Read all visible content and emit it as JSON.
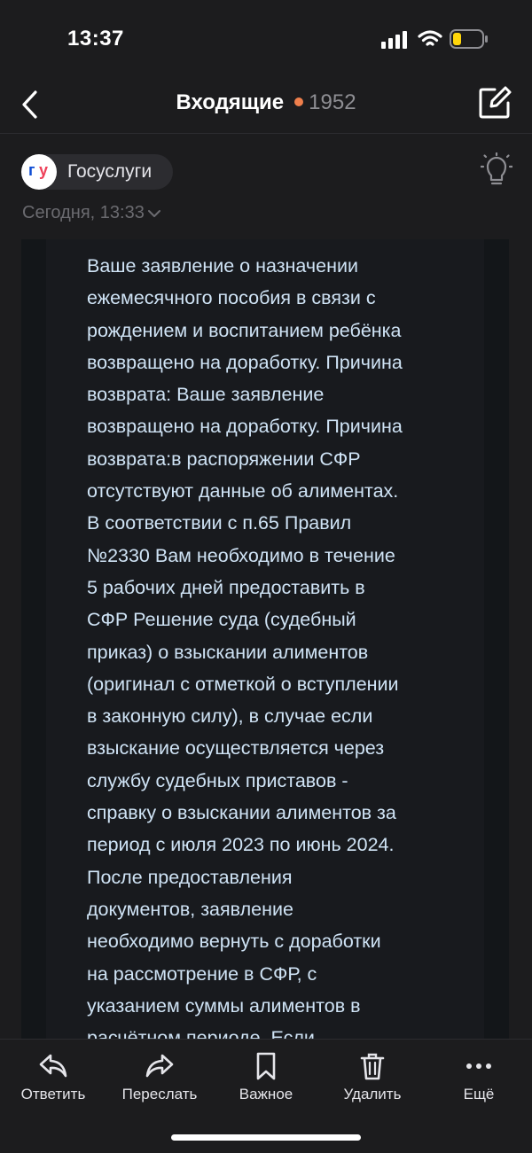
{
  "status_bar": {
    "time": "13:37",
    "battery_color": "#ffd60a"
  },
  "nav": {
    "title": "Входящие",
    "unread_count": "1952",
    "dot_color": "#ef7f4c"
  },
  "sender": {
    "name": "Госуслуги",
    "logo_text_g": "г",
    "logo_text_u": "у",
    "logo_colors": [
      "#0d4cd3",
      "#ee3f58"
    ]
  },
  "date": {
    "label": "Сегодня, 13:33"
  },
  "message": {
    "lines": [
      "Ваше заявление о назначении",
      "ежемесячного пособия в связи с",
      "рождением и воспитанием ребёнка",
      "возвращено на доработку. Причина",
      "возврата: Ваше заявление",
      "возвращено на доработку. Причина",
      "возврата:в распоряжении СФР",
      "отсутствуют данные об алиментах.",
      "В соответствии с п.65 Правил",
      "№2330 Вам необходимо в течение",
      "5 рабочих дней предоставить в",
      "СФР Решение суда (судебный",
      "приказ) о взыскании алиментов",
      "(оригинал с отметкой о вступлении",
      "в законную силу), в случае если",
      "взыскание осуществляется через",
      "службу судебных приставов -",
      "справку о взыскании алиментов за",
      "период с июля 2023 по июнь 2024.",
      "После предоставления",
      "документов, заявление",
      "необходимо вернуть с доработки",
      "на рассмотрение в СФР, с",
      "указанием суммы алиментов в",
      "расчётном периоде. Если"
    ]
  },
  "toolbar": {
    "reply": "Ответить",
    "forward": "Переслать",
    "important": "Важное",
    "delete": "Удалить",
    "more": "Ещё"
  }
}
